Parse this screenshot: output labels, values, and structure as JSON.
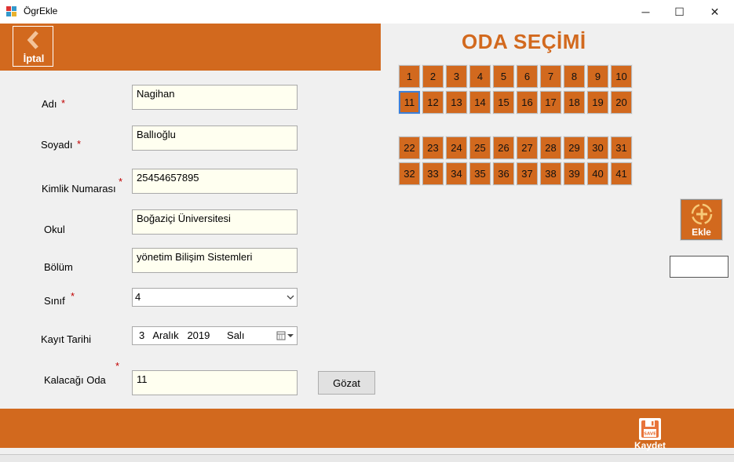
{
  "window": {
    "title": "ÖgrEkle",
    "minimize": "─",
    "maximize": "☐",
    "close": "✕"
  },
  "header": {
    "cancel_label": "İptal"
  },
  "form": {
    "fields": [
      {
        "label": "Adı",
        "required": "*",
        "value": "Nagihan"
      },
      {
        "label": "Soyadı",
        "required": "*",
        "value": "Ballıoğlu"
      },
      {
        "label": "Kimlik Numarası",
        "required": "*",
        "value": "25454657895"
      },
      {
        "label": "Okul",
        "value": "Boğaziçi Üniversitesi"
      },
      {
        "label": "Bölüm",
        "value": "yönetim Bilişim Sistemleri"
      }
    ],
    "class": {
      "label": "Sınıf",
      "required": "*",
      "value": "4"
    },
    "date": {
      "label": "Kayıt Tarihi",
      "day": "3",
      "month": "Aralık",
      "year": "2019",
      "weekday": "Salı"
    },
    "room": {
      "label": "Kalacağı Oda",
      "required": "*",
      "value": "11",
      "browse_label": "Gözat"
    }
  },
  "room_selection": {
    "title": "ODA SEÇİMİ",
    "block1": [
      [
        "1",
        "2",
        "3",
        "4",
        "5",
        "6",
        "7",
        "8",
        "9",
        "10"
      ],
      [
        "11",
        "12",
        "13",
        "14",
        "15",
        "16",
        "17",
        "18",
        "19",
        "20"
      ]
    ],
    "block2": [
      [
        "22",
        "23",
        "24",
        "25",
        "26",
        "27",
        "28",
        "29",
        "30",
        "31"
      ],
      [
        "32",
        "33",
        "34",
        "35",
        "36",
        "37",
        "38",
        "39",
        "40",
        "41"
      ]
    ],
    "selected": "11",
    "add_label": "Ekle",
    "extra_value": ""
  },
  "footer": {
    "save_label": "Kaydet",
    "save_icon_text": "SAVE"
  },
  "colors": {
    "accent": "#d2691e",
    "field_bg": "#fffff0",
    "required": "#c00000"
  }
}
